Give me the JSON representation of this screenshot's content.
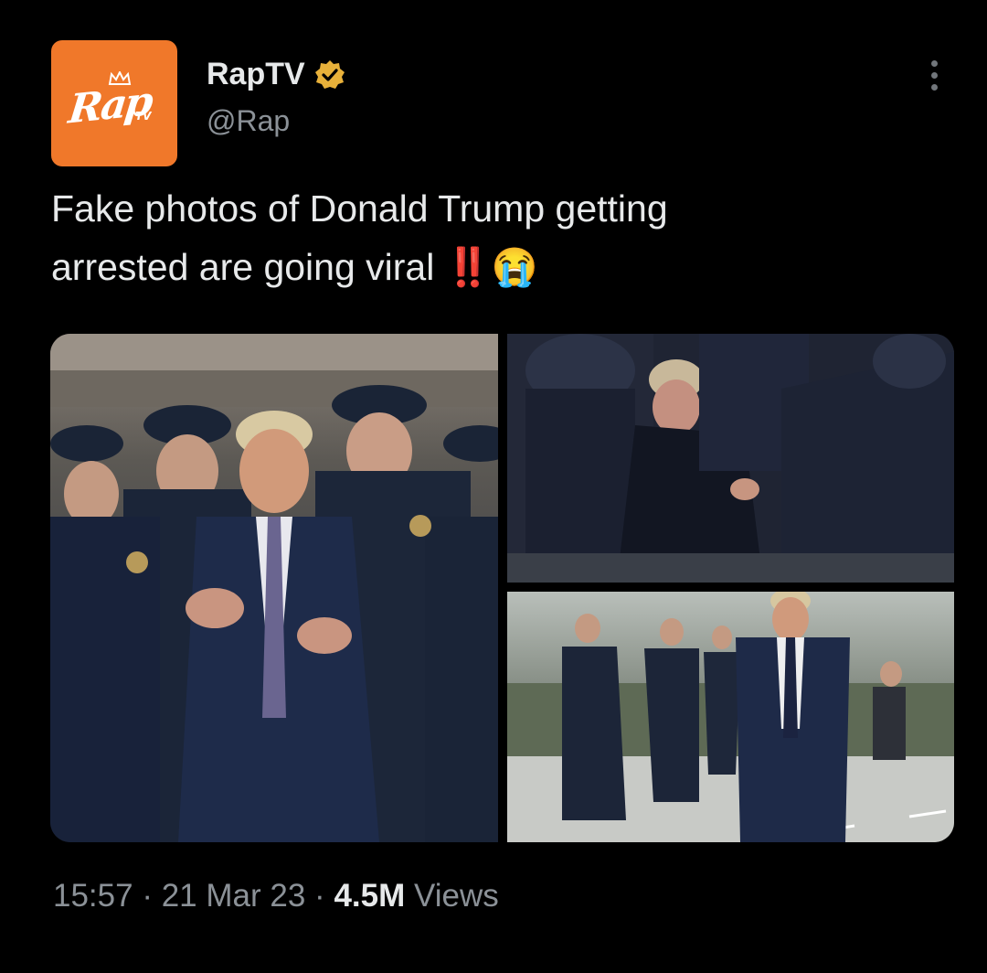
{
  "account": {
    "avatar_logo_text": "Rap",
    "avatar_logo_sub": "TV",
    "display_name": "RapTV",
    "handle": "@Rap",
    "verified_icon": "gold-verified-badge-icon",
    "more_icon": "more-vertical-icon"
  },
  "tweet": {
    "text_line1": "Fake photos of Donald Trump getting",
    "text_line2": "arrested are going viral",
    "emoji": "‼️😭"
  },
  "media": {
    "count": 3
  },
  "meta": {
    "time": "15:57",
    "separator": "·",
    "date": "21 Mar 23",
    "views_count": "4.5M",
    "views_label": "Views"
  },
  "colors": {
    "background": "#000000",
    "text": "#e7e9ea",
    "muted": "#8b9197",
    "avatar_bg": "#f0782a",
    "verified": "#e8b13a"
  }
}
